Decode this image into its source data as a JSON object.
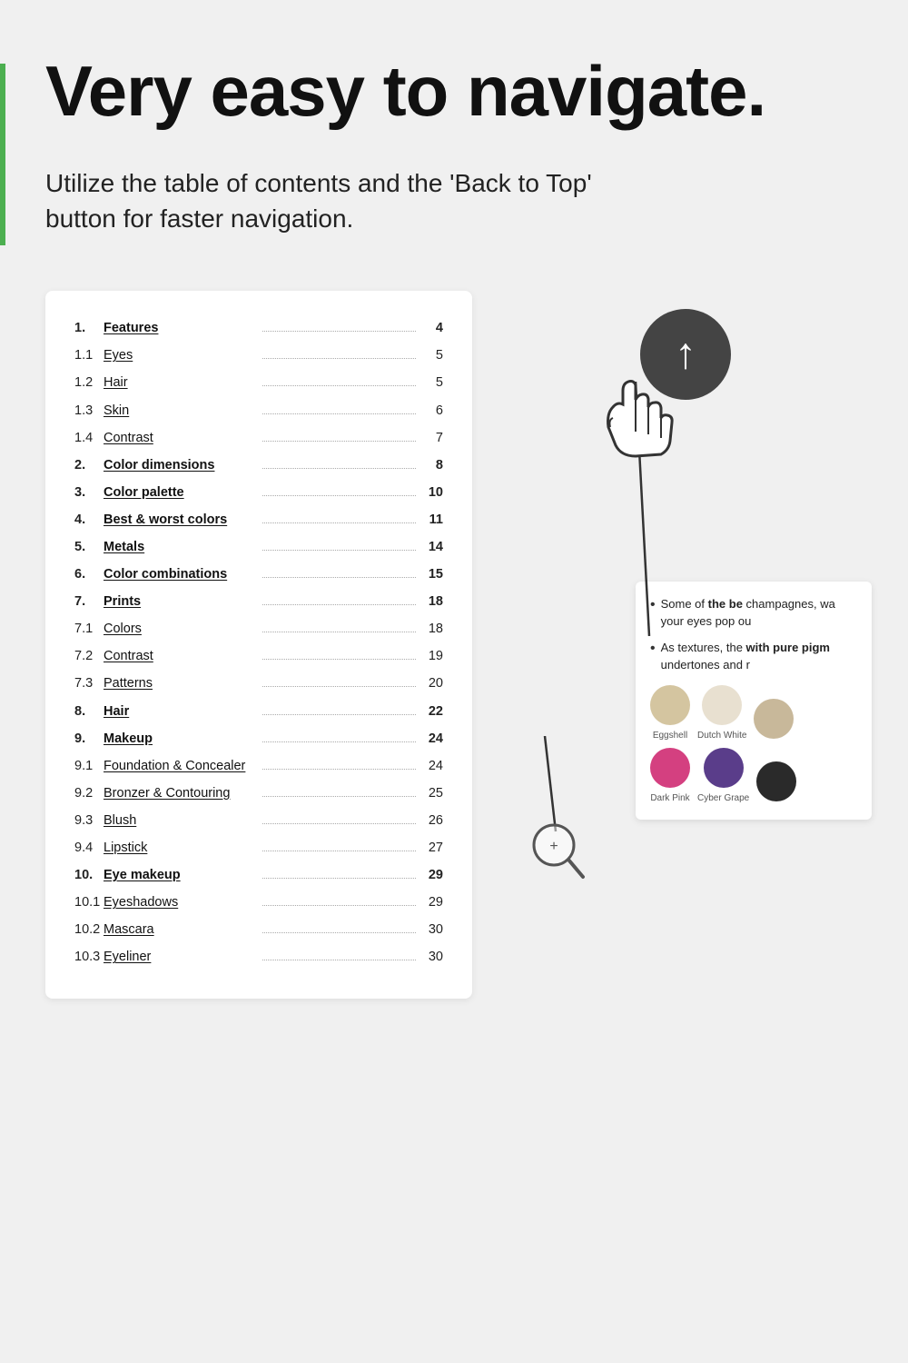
{
  "hero": {
    "title": "Very easy to navigate.",
    "subtitle": "Utilize the table of contents and the 'Back to Top' button for faster navigation.",
    "accent_color": "#4caf50"
  },
  "toc": {
    "items": [
      {
        "num": "1.",
        "label": "Features",
        "page": "4",
        "bold": true,
        "underline": true,
        "page_bold": true
      },
      {
        "num": "1.1",
        "label": "Eyes",
        "page": "5",
        "bold": false,
        "underline": true,
        "page_bold": false
      },
      {
        "num": "1.2",
        "label": "Hair",
        "page": "5",
        "bold": false,
        "underline": true,
        "page_bold": false
      },
      {
        "num": "1.3",
        "label": "Skin",
        "page": "6",
        "bold": false,
        "underline": true,
        "page_bold": false
      },
      {
        "num": "1.4",
        "label": "Contrast",
        "page": "7",
        "bold": false,
        "underline": true,
        "page_bold": false
      },
      {
        "num": "2.",
        "label": "Color dimensions",
        "page": "8",
        "bold": true,
        "underline": true,
        "page_bold": true
      },
      {
        "num": "3.",
        "label": "Color palette",
        "page": "10",
        "bold": true,
        "underline": true,
        "page_bold": true
      },
      {
        "num": "4.",
        "label": "Best & worst colors",
        "page": "11",
        "bold": true,
        "underline": true,
        "page_bold": true
      },
      {
        "num": "5.",
        "label": "Metals",
        "page": "14",
        "bold": true,
        "underline": true,
        "page_bold": true
      },
      {
        "num": "6.",
        "label": "Color combinations",
        "page": "15",
        "bold": true,
        "underline": true,
        "page_bold": true
      },
      {
        "num": "7.",
        "label": "Prints",
        "page": "18",
        "bold": true,
        "underline": true,
        "page_bold": true
      },
      {
        "num": "7.1",
        "label": "Colors",
        "page": "18",
        "bold": false,
        "underline": true,
        "page_bold": false
      },
      {
        "num": "7.2",
        "label": "Contrast",
        "page": "19",
        "bold": false,
        "underline": true,
        "page_bold": false
      },
      {
        "num": "7.3",
        "label": "Patterns",
        "page": "20",
        "bold": false,
        "underline": true,
        "page_bold": false
      },
      {
        "num": "8.",
        "label": "Hair",
        "page": "22",
        "bold": true,
        "underline": true,
        "page_bold": true
      },
      {
        "num": "9.",
        "label": "Makeup",
        "page": "24",
        "bold": true,
        "underline": true,
        "page_bold": true
      },
      {
        "num": "9.1",
        "label": "Foundation & Concealer",
        "page": "24",
        "bold": false,
        "underline": true,
        "page_bold": false
      },
      {
        "num": "9.2",
        "label": "Bronzer & Contouring",
        "page": "25",
        "bold": false,
        "underline": true,
        "page_bold": false
      },
      {
        "num": "9.3",
        "label": "Blush",
        "page": "26",
        "bold": false,
        "underline": true,
        "page_bold": false
      },
      {
        "num": "9.4",
        "label": "Lipstick",
        "page": "27",
        "bold": false,
        "underline": true,
        "page_bold": false
      },
      {
        "num": "10.",
        "label": "Eye makeup",
        "page": "29",
        "bold": true,
        "underline": true,
        "page_bold": true
      },
      {
        "num": "10.1",
        "label": "Eyeshadows",
        "page": "29",
        "bold": false,
        "underline": true,
        "page_bold": false
      },
      {
        "num": "10.2",
        "label": "Mascara",
        "page": "30",
        "bold": false,
        "underline": true,
        "page_bold": false
      },
      {
        "num": "10.3",
        "label": "Eyeliner",
        "page": "30",
        "bold": false,
        "underline": true,
        "page_bold": false
      }
    ]
  },
  "snippet": {
    "bullet1": "Some of the be champagnes, wa your eyes pop ou",
    "bullet2_part1": "As textures, the",
    "bullet2_bold": "with pure pigm",
    "bullet2_part2": "undertones and r",
    "swatches": [
      {
        "label": "Eggshell",
        "color": "#d4c5a0"
      },
      {
        "label": "Dutch White",
        "color": "#e8e0d0"
      },
      {
        "label": "",
        "color": "#c8b89a"
      },
      {
        "label": "Dark Pink",
        "color": "#d44080"
      },
      {
        "label": "Cyber Grape",
        "color": "#5a3d8a"
      },
      {
        "label": "",
        "color": "#2a2a2a"
      }
    ]
  }
}
